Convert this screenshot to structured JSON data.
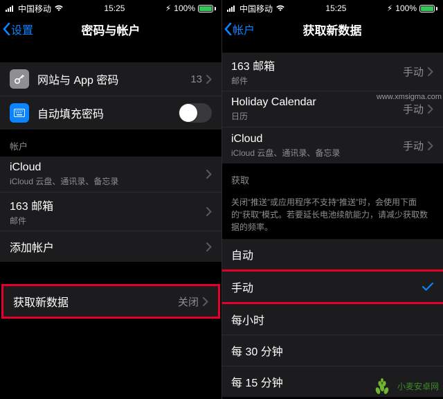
{
  "left": {
    "status": {
      "carrier": "中国移动",
      "time": "15:25",
      "battery_pct": "100%"
    },
    "nav": {
      "back": "设置",
      "title": "密码与帐户"
    },
    "passwords": {
      "websites_label": "网站与 App 密码",
      "websites_count": "13",
      "autofill_label": "自动填充密码"
    },
    "accounts_header": "帐户",
    "accounts": [
      {
        "title": "iCloud",
        "subtitle": "iCloud 云盘、通讯录、备忘录"
      },
      {
        "title": "163 邮箱",
        "subtitle": "邮件"
      }
    ],
    "add_account": "添加帐户",
    "fetch": {
      "label": "获取新数据",
      "value": "关闭"
    }
  },
  "right": {
    "status": {
      "carrier": "中国移动",
      "time": "15:25",
      "battery_pct": "100%"
    },
    "nav": {
      "back": "帐户",
      "title": "获取新数据"
    },
    "accounts": [
      {
        "title": "163 邮箱",
        "subtitle": "邮件",
        "value": "手动"
      },
      {
        "title": "Holiday Calendar",
        "subtitle": "日历",
        "value": "手动"
      },
      {
        "title": "iCloud",
        "subtitle": "iCloud 云盘、通讯录、备忘录",
        "value": "手动"
      }
    ],
    "fetch_header": "获取",
    "fetch_footer": "关闭“推送”或应用程序不支持“推送”时，会使用下面的“获取”模式。若要延长电池续航能力，请减少获取数据的频率。",
    "options": {
      "auto": "自动",
      "manual": "手动",
      "hourly": "每小时",
      "thirty": "每 30 分钟",
      "fifteen": "每 15 分钟"
    }
  },
  "watermarks": {
    "wm1": "www.xmsigma.com",
    "wm2": "小麦安卓网"
  },
  "colors": {
    "accent": "#0a84ff",
    "highlight": "#e4002b"
  }
}
